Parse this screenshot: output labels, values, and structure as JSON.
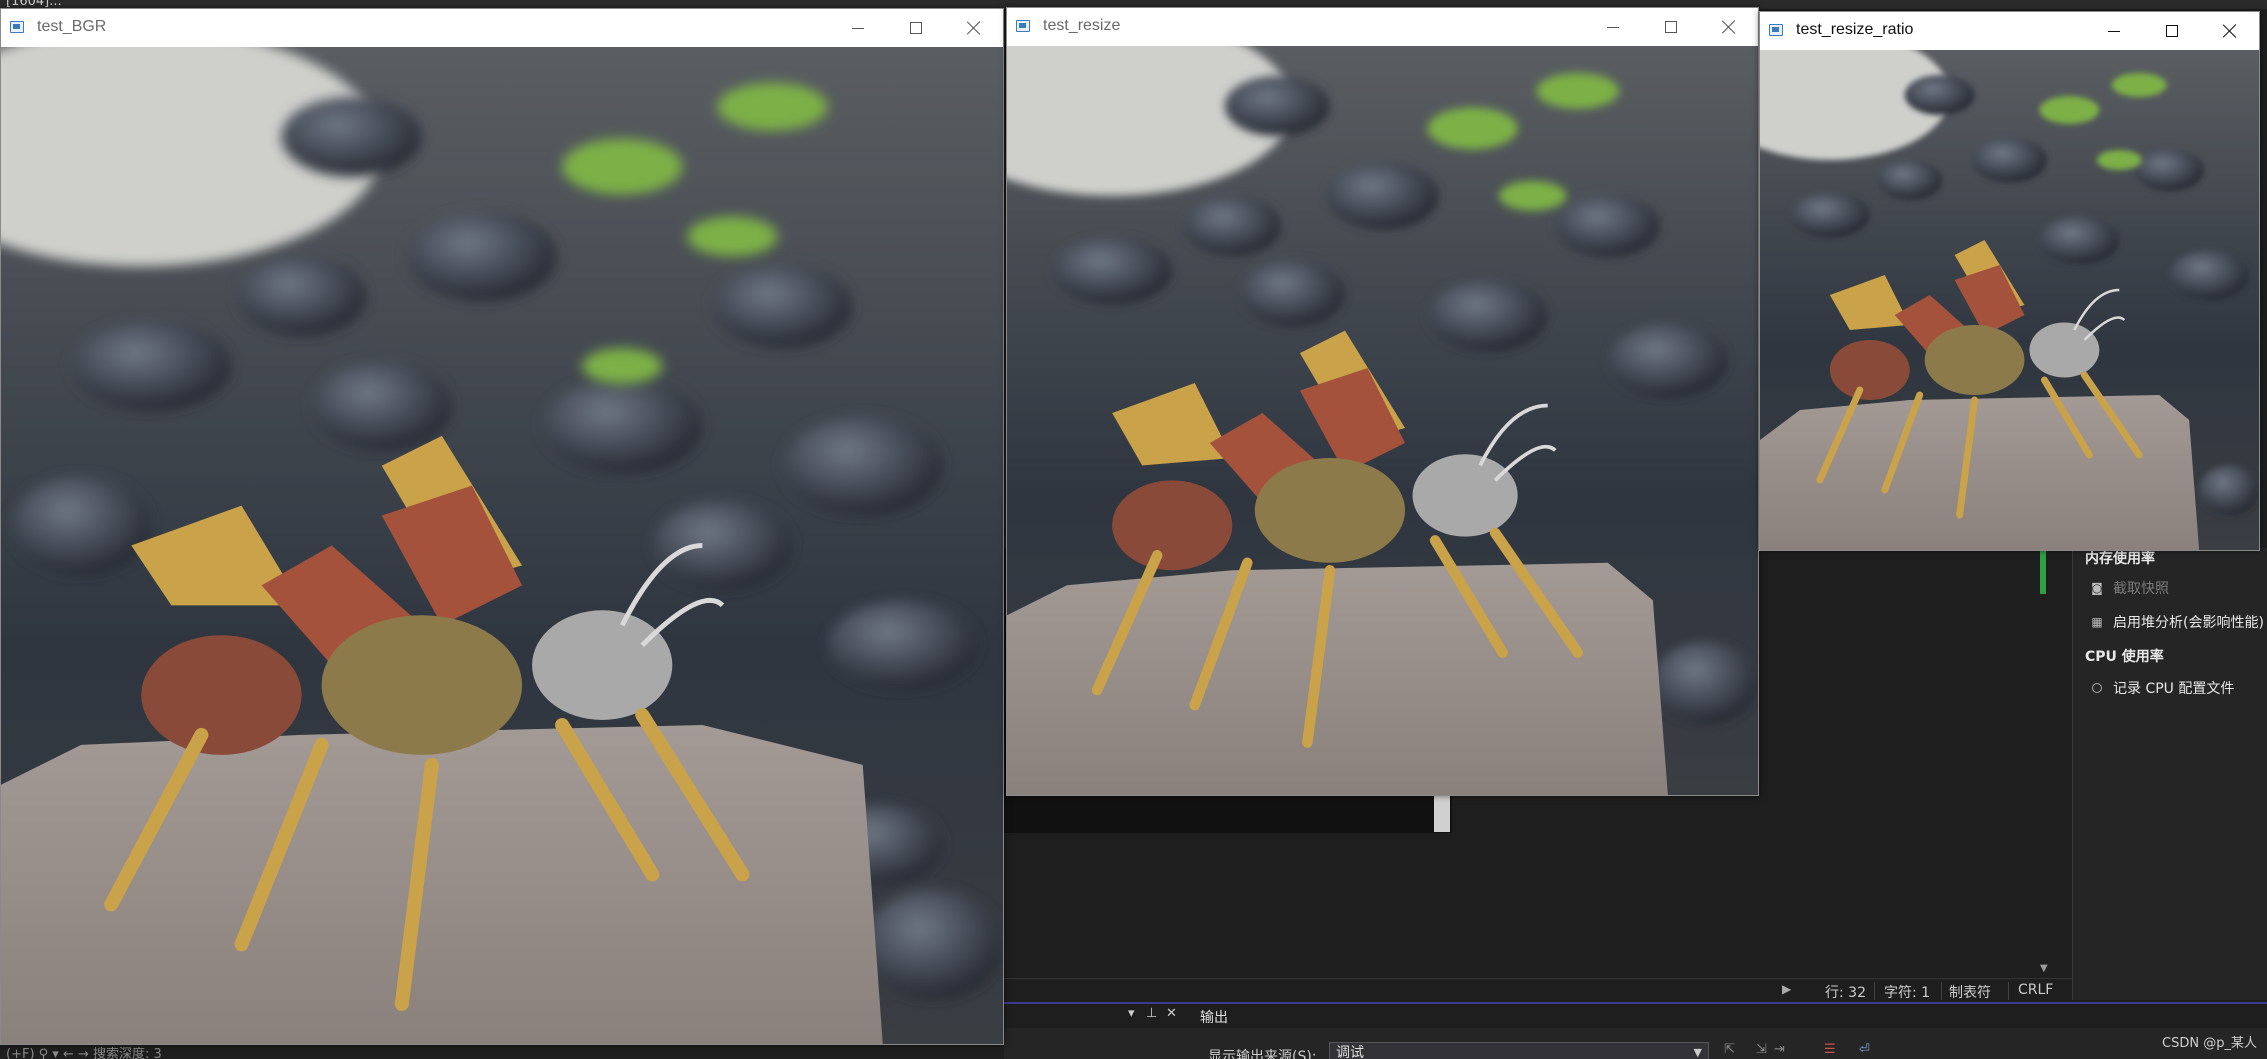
{
  "ide": {
    "title_fragment": "[1604]...",
    "left_bottom_text": "(+F)  ⚲ ▾  ← →  搜索深度: 3",
    "diagnostics": {
      "memory_heading": "内存使用率",
      "snapshot_label": "截取快照",
      "heap_label": "启用堆分析(会影响性能)",
      "cpu_heading": "CPU 使用率",
      "cpu_profile_label": "记录 CPU 配置文件"
    },
    "status": {
      "line": "行: 32",
      "char": "字符: 1",
      "indent": "制表符",
      "eol": "CRLF"
    },
    "output": {
      "tab_label": "输出",
      "source_label": "显示输出来源(S):",
      "source_value": "调试"
    },
    "watermark": "CSDN @p_某人"
  },
  "windows": [
    {
      "title": "test_BGR",
      "active": false
    },
    {
      "title": "test_resize",
      "active": false
    },
    {
      "title": "test_resize_ratio",
      "active": true
    }
  ],
  "colors": {
    "ide_bg": "#1e1e1e",
    "panel_bg": "#252526",
    "accent_green": "#2ea043",
    "output_border": "#3b3b8c"
  }
}
